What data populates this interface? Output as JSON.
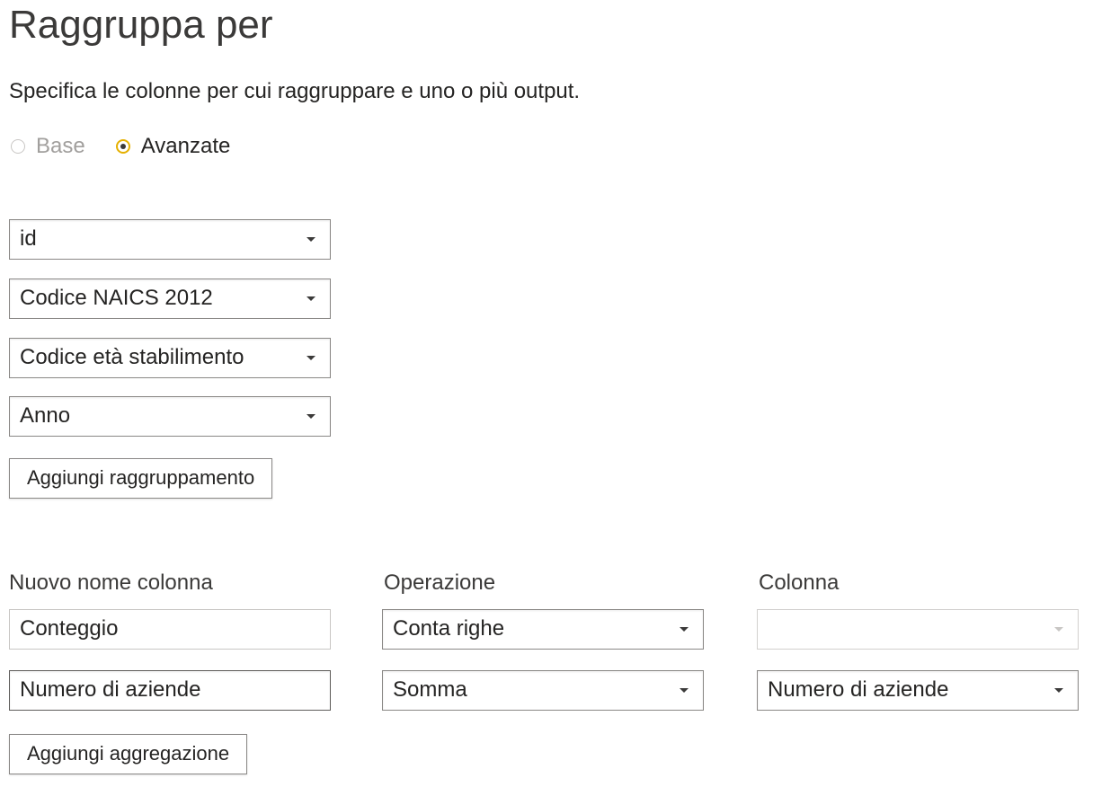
{
  "dialog": {
    "title": "Raggruppa per",
    "subtitle": "Specifica le colonne per cui raggruppare e uno o più output."
  },
  "mode": {
    "options": [
      {
        "label": "Base",
        "selected": false,
        "enabled": false
      },
      {
        "label": "Avanzate",
        "selected": true,
        "enabled": true
      }
    ]
  },
  "grouping": {
    "fields": [
      {
        "value": "id"
      },
      {
        "value": "Codice NAICS 2012"
      },
      {
        "value": "Codice età stabilimento"
      },
      {
        "value": "Anno"
      }
    ],
    "add_button_label": "Aggiungi raggruppamento"
  },
  "aggregations": {
    "headers": {
      "new_column_name": "Nuovo nome colonna",
      "operation": "Operazione",
      "column": "Colonna"
    },
    "rows": [
      {
        "name": "Conteggio",
        "operation": "Conta righe",
        "column": ""
      },
      {
        "name": "Numero di aziende",
        "operation": "Somma",
        "column": "Numero di aziende"
      }
    ],
    "add_button_label": "Aggiungi aggregazione"
  },
  "colors": {
    "radio_accent": "#e5b000",
    "text": "#252423",
    "disabled_text": "#a19f9d",
    "border": "#8a8886"
  }
}
